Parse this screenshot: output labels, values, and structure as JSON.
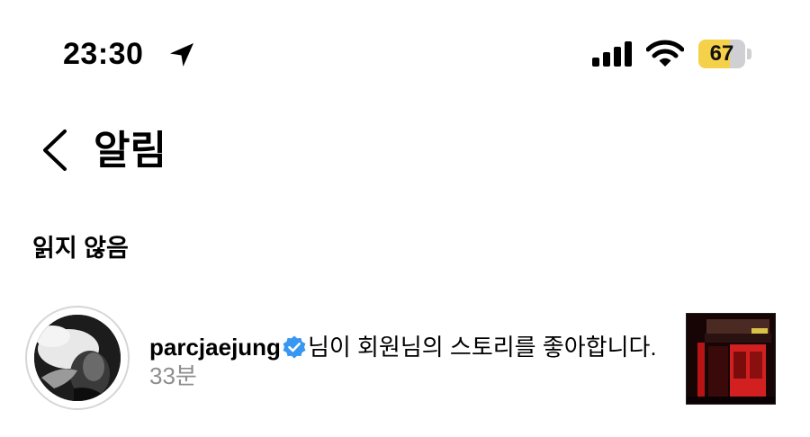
{
  "status_bar": {
    "time": "23:30",
    "battery": "67",
    "battery_level": 0.67,
    "icons": [
      "location-arrow-icon",
      "cellular-signal-icon",
      "wifi-icon",
      "battery-icon"
    ]
  },
  "header": {
    "title": "알림",
    "back_icon": "chevron-left-icon"
  },
  "section": {
    "label": "읽지 않음"
  },
  "notification": {
    "username": "parcjaejung",
    "verified_icon": "verified-badge-icon",
    "message": "님이 회원님의 스토리를 좋아합니다.",
    "time": "33분",
    "colors": {
      "verified": "#3897f0",
      "timestamp": "#8e8e8e",
      "battery_fill": "#f5d14a"
    }
  }
}
